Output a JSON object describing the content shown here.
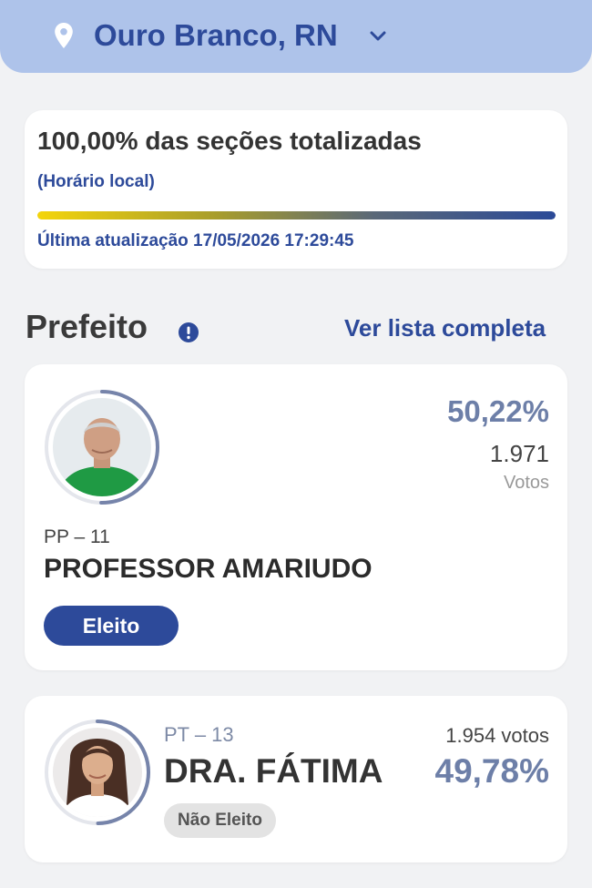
{
  "header": {
    "location": "Ouro Branco, RN",
    "location_icon": "map-pin-icon",
    "dropdown_icon": "chevron-down-icon"
  },
  "progress": {
    "title": "100,00% das seções totalizadas",
    "subtitle": "(Horário local)",
    "percent": 100,
    "last_update": "Última atualização 17/05/2026 17:29:45"
  },
  "section": {
    "title": "Prefeito",
    "info_icon": "info-icon",
    "see_all_label": "Ver lista completa"
  },
  "candidates": [
    {
      "party": "PP – 11",
      "name": "PROFESSOR AMARIUDO",
      "percent": "50,22%",
      "votes": "1.971",
      "votes_label": "Votos",
      "status": "Eleito",
      "ring_fraction": 0.5022,
      "ring_color": "#7684aa"
    },
    {
      "party": "PT – 13",
      "name": "DRA. FÁTIMA",
      "percent": "49,78%",
      "votes": "1.954 votos",
      "status": "Não Eleito",
      "ring_fraction": 0.4978,
      "ring_color": "#7684aa"
    }
  ],
  "colors": {
    "header_bg": "#aec3ea",
    "accent": "#2d4a9a",
    "percent": "#6d7fa8"
  }
}
